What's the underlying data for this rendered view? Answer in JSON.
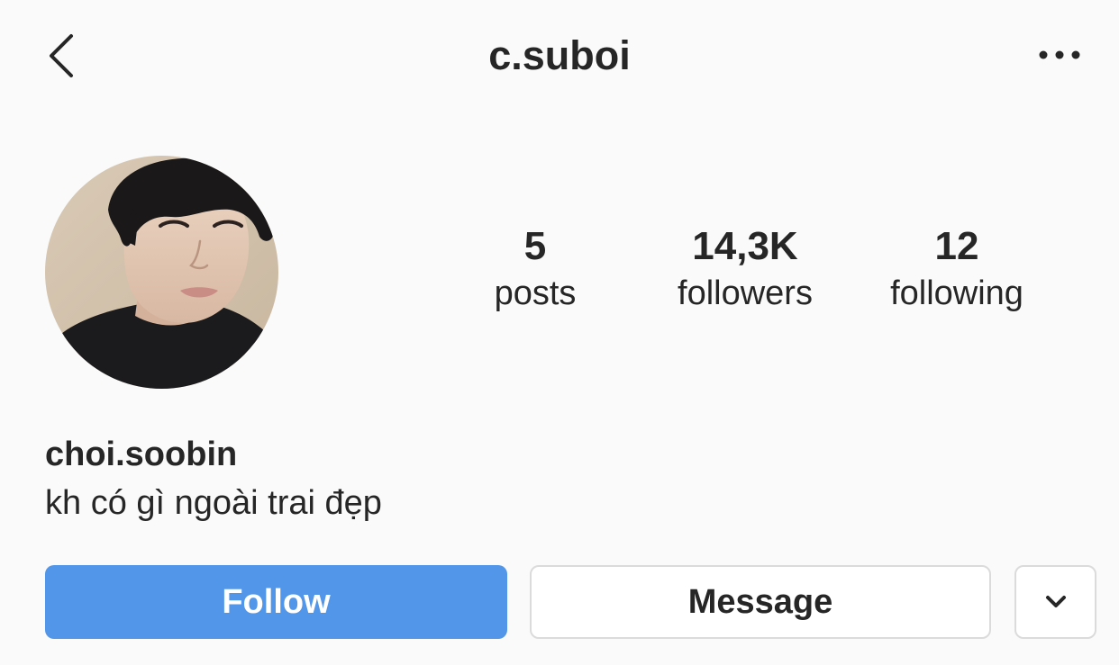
{
  "header": {
    "username": "c.suboi",
    "back_icon": "chevron-left-icon",
    "more_icon": "ellipsis-horizontal-icon"
  },
  "profile": {
    "avatar_description_icon": "profile-photo",
    "stats": [
      {
        "value": "5",
        "label": "posts"
      },
      {
        "value": "14,3K",
        "label": "followers"
      },
      {
        "value": "12",
        "label": "following"
      }
    ],
    "full_name": "choi.soobin",
    "bio": "kh có gì ngoài trai đẹp"
  },
  "actions": {
    "follow_label": "Follow",
    "message_label": "Message",
    "dropdown_icon": "chevron-down-icon"
  },
  "colors": {
    "background": "#fafafa",
    "text": "#262626",
    "follow_button": "#5196e8",
    "border": "#dbdbdb"
  }
}
